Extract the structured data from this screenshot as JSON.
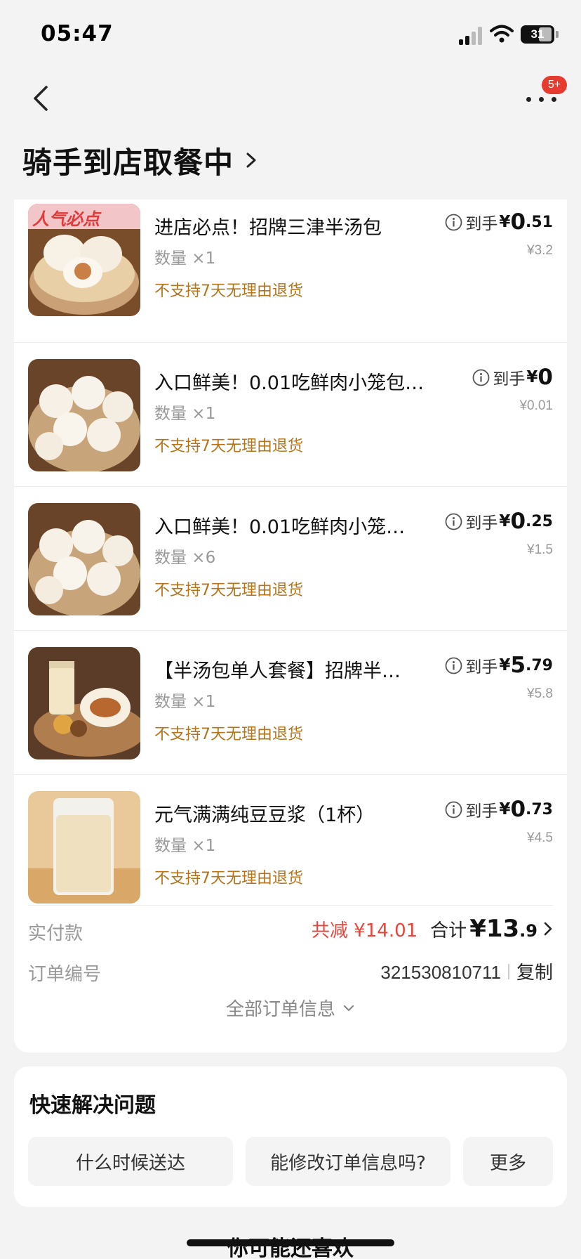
{
  "status_bar": {
    "time": "05:47",
    "battery": "31"
  },
  "nav": {
    "back_icon": "chevron-left-icon",
    "more_icon": "more-dots-icon",
    "badge": "5+"
  },
  "header": {
    "title": "骑手到店取餐中"
  },
  "items": [
    {
      "name": "进店必点！招牌三津半汤包",
      "qty": "数量 ×1",
      "policy": "不支持7天无理由退货",
      "price_label": "到手",
      "price_int": "0",
      "price_dec": ".51",
      "orig_price": "¥3.2",
      "img_tag": "人气必点"
    },
    {
      "name": "入口鲜美！0.01吃鲜肉小笼包（…",
      "qty": "数量 ×1",
      "policy": "不支持7天无理由退货",
      "price_label": "到手",
      "price_int": "0",
      "price_dec": "",
      "orig_price": "¥0.01"
    },
    {
      "name": "入口鲜美！0.01吃鲜肉小笼包…",
      "qty": "数量 ×6",
      "policy": "不支持7天无理由退货",
      "price_label": "到手",
      "price_int": "0",
      "price_dec": ".25",
      "orig_price": "¥1.5"
    },
    {
      "name": "【半汤包单人套餐】招牌半汤…",
      "qty": "数量 ×1",
      "policy": "不支持7天无理由退货",
      "price_label": "到手",
      "price_int": "5",
      "price_dec": ".79",
      "orig_price": "¥5.8"
    },
    {
      "name": "元气满满纯豆豆浆（1杯）",
      "qty": "数量 ×1",
      "policy": "不支持7天无理由退货",
      "price_label": "到手",
      "price_int": "0",
      "price_dec": ".73",
      "orig_price": "¥4.5"
    }
  ],
  "currency": "¥",
  "summary": {
    "paid_label": "实付款",
    "discount": "共减 ¥14.01",
    "total_label": "合计",
    "total_int": "¥13",
    "total_dec": ".9",
    "order_no_label": "订单编号",
    "order_no": "321530810711",
    "copy_label": "复制",
    "all_info": "全部订单信息"
  },
  "quick": {
    "title": "快速解决问题",
    "buttons": [
      "什么时候送达",
      "能修改订单信息吗?",
      "更多"
    ]
  },
  "recommend_title": "你可能还喜欢",
  "colors": {
    "accent_red": "#e8443a",
    "policy_orange": "#b5741a"
  }
}
